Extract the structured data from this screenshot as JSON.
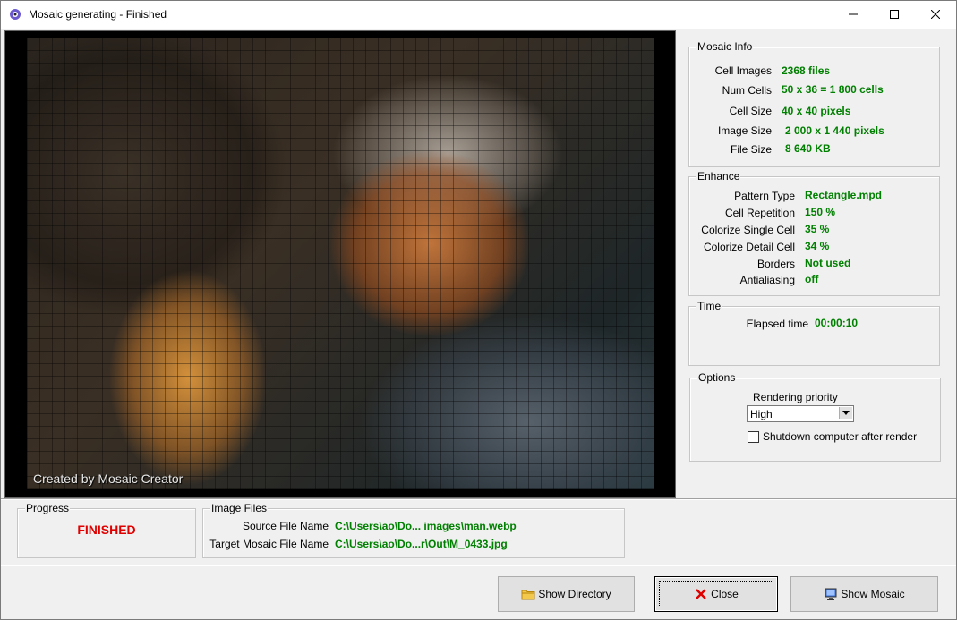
{
  "window": {
    "title": "Mosaic generating - Finished"
  },
  "preview": {
    "watermark": "Created by Mosaic Creator"
  },
  "mosaic_info": {
    "title": "Mosaic Info",
    "rows": [
      {
        "label": "Cell Images",
        "value": "2368 files"
      },
      {
        "label": "Num Cells",
        "value": "50 x 36 = 1 800 cells"
      },
      {
        "label": "Cell Size",
        "value": "40 x 40  pixels"
      },
      {
        "label": "Image Size",
        "value": "2 000  x  1 440  pixels"
      },
      {
        "label": "File Size",
        "value": "8 640 KB"
      }
    ]
  },
  "enhance": {
    "title": "Enhance",
    "rows": [
      {
        "label": "Pattern Type",
        "value": "Rectangle.mpd"
      },
      {
        "label": "Cell Repetition",
        "value": "150 %"
      },
      {
        "label": "Colorize Single Cell",
        "value": "35 %"
      },
      {
        "label": "Colorize Detail Cell",
        "value": "34 %"
      },
      {
        "label": "Borders",
        "value": "Not used"
      },
      {
        "label": "Antialiasing",
        "value": "off"
      }
    ]
  },
  "time": {
    "title": "Time",
    "label": "Elapsed time",
    "value": "00:00:10"
  },
  "options": {
    "title": "Options",
    "priority_label": "Rendering priority",
    "priority_value": "High",
    "shutdown_label": "Shutdown computer after render",
    "shutdown_checked": false
  },
  "progress": {
    "title": "Progress",
    "status": "FINISHED",
    "status_color": "#e00000"
  },
  "image_files": {
    "title": "Image Files",
    "source_label": "Source File Name",
    "source_value": "C:\\Users\\ao\\Do... images\\man.webp",
    "target_label": "Target Mosaic File Name",
    "target_value": "C:\\Users\\ao\\Do...r\\Out\\M_0433.jpg"
  },
  "buttons": {
    "show_directory": "Show Directory",
    "close": "Close",
    "show_mosaic": "Show Mosaic"
  },
  "icons": [
    "app-icon",
    "minimize-icon",
    "maximize-icon",
    "close-window-icon",
    "folder-icon",
    "close-x-icon",
    "monitor-icon",
    "chevron-down-icon"
  ]
}
